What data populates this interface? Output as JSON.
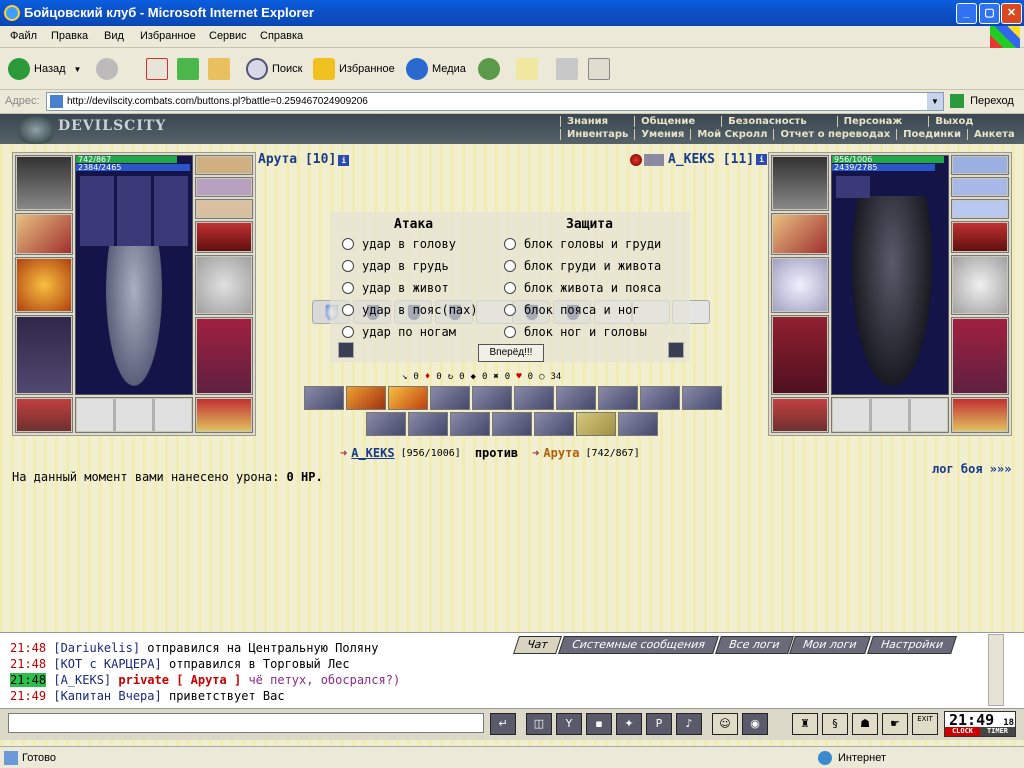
{
  "window": {
    "title": "Бойцовский клуб - Microsoft Internet Explorer",
    "min": "_",
    "max": "▢",
    "close": "✕"
  },
  "menu": [
    "Файл",
    "Правка",
    "Вид",
    "Избранное",
    "Сервис",
    "Справка"
  ],
  "toolbar": {
    "back": "Назад",
    "search": "Поиск",
    "favorites": "Избранное",
    "media": "Медиа"
  },
  "address": {
    "label": "Адрес:",
    "url": "http://devilscity.combats.com/buttons.pl?battle=0.259467024909206",
    "go": "Переход"
  },
  "game": {
    "logo": "DEVILSCITY",
    "nav_top": [
      "Знания",
      "Общение",
      "Безопасность",
      "Персонаж",
      "Выход"
    ],
    "nav_bottom": [
      "Инвентарь",
      "Умения",
      "Мой Скролл",
      "Отчет о переводах",
      "Поединки",
      "Анкета"
    ]
  },
  "player": {
    "name": "Арута [10]",
    "hp": "742/867",
    "mp": "2384/2465",
    "hp_fraction": 0.856,
    "mp_fraction": 0.967
  },
  "enemy": {
    "name": "A_KEKS [11]",
    "hp": "956/1006",
    "mp": "2439/2785",
    "hp_fraction": 0.95,
    "mp_fraction": 0.876
  },
  "attack": {
    "title": "Атака",
    "options": [
      "удар в голову",
      "удар в грудь",
      "удар в живот",
      "удар в пояс(пах)",
      "удар по ногам"
    ]
  },
  "defense": {
    "title": "Защита",
    "options": [
      "блок головы и груди",
      "блок груди и живота",
      "блок живота и пояса",
      "блок пояса и ног",
      "блок ног и головы"
    ]
  },
  "forward_button": "Вперёд!!!",
  "stats": [
    "0",
    "0",
    "0",
    "0",
    "0",
    "0",
    "34"
  ],
  "versus": {
    "enemy": "A_KEKS",
    "enemy_hp": "[956/1006]",
    "word": "против",
    "player": "Арута",
    "player_hp": "[742/867]"
  },
  "damage": {
    "text": "На данный момент вами нанесено урона:",
    "value": "0 HP."
  },
  "fight_log_link": "лог боя »»»",
  "chat": {
    "tabs": [
      "Чат",
      "Системные сообщения",
      "Все логи",
      "Мои логи",
      "Настройки"
    ],
    "lines": [
      {
        "time": "21:48",
        "nick": "[Dariukelis]",
        "text": "отправился на Центральную Поляну"
      },
      {
        "time": "21:48",
        "nick": "[КОТ с КАРЦЕРА]",
        "text": "отправился в Торговый Лес"
      },
      {
        "time": "21:48",
        "nick": "[A_KEKS]",
        "private": "private [ Арута ]",
        "text": "чё петух, обосрался?)"
      },
      {
        "time": "21:49",
        "nick": "[Капитан Вчера]",
        "text": "приветствует Вас"
      }
    ]
  },
  "clock": {
    "time": "21:49",
    "seconds": "18",
    "label_clock": "CLOCK",
    "label_timer": "TIMER",
    "exit": "EXIT"
  },
  "status": {
    "left": "Готово",
    "right": "Интернет"
  }
}
